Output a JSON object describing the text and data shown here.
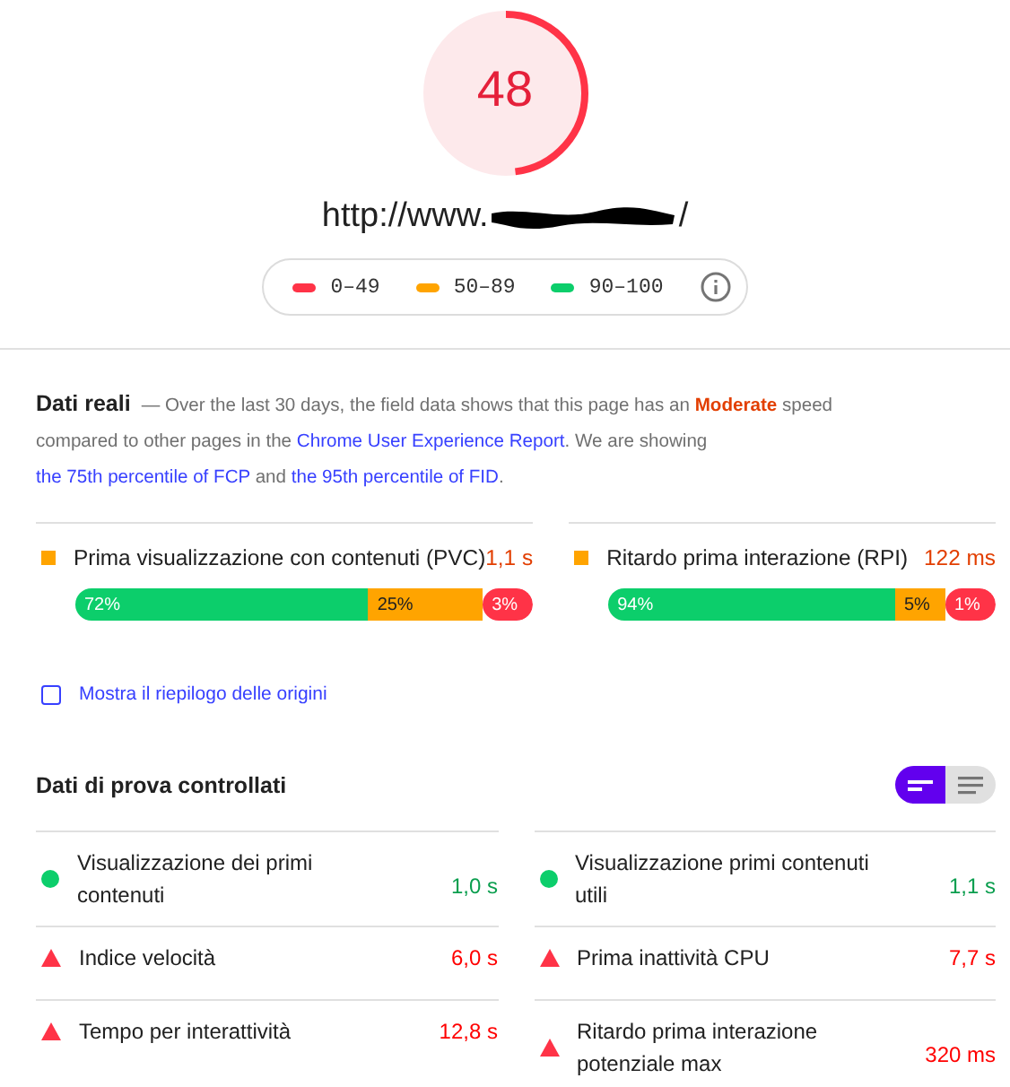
{
  "score": {
    "value": "48"
  },
  "url": {
    "text": "http://www.",
    "suffix": "/"
  },
  "legend": [
    {
      "label": "0–49",
      "color": "#ff3347"
    },
    {
      "label": "50–89",
      "color": "#ffa400"
    },
    {
      "label": "90–100",
      "color": "#0cce6b"
    }
  ],
  "field_data": {
    "title": "Dati reali",
    "description": [
      {
        "kind": "plain",
        "text": "— Over the last 30 days, the field data shows that this page has an "
      },
      {
        "kind": "rating",
        "text": "Moderate"
      },
      {
        "kind": "plain",
        "text": " speed compared to other pages in the "
      },
      {
        "kind": "link",
        "text": "Chrome User Experience Report"
      },
      {
        "kind": "plain",
        "text": ". We are showing "
      },
      {
        "kind": "link",
        "text": "the 75th percentile of FCP"
      },
      {
        "kind": "plain",
        "text": " and "
      },
      {
        "kind": "link",
        "text": "the 95th percentile of FID"
      },
      {
        "kind": "plain",
        "text": "."
      }
    ],
    "metrics": [
      {
        "name": "Prima visualizzazione con contenuti (PVC)",
        "value": "1,1 s",
        "kind": "average",
        "distribution": [
          {
            "label": "72%",
            "kind": "fast"
          },
          {
            "label": "25%",
            "kind": "average"
          },
          {
            "label": "3%",
            "kind": "slow"
          }
        ]
      },
      {
        "name": "Ritardo prima interazione (RPI)",
        "value": "122 ms",
        "kind": "average",
        "distribution": [
          {
            "label": "94%",
            "kind": "fast"
          },
          {
            "label": "5%",
            "kind": "average"
          },
          {
            "label": "1%",
            "kind": "slow"
          }
        ]
      }
    ]
  },
  "origin_summary": {
    "label": "Mostra il riepilogo delle origini",
    "checked": false
  },
  "lab_data": {
    "title": "Dati di prova controllati",
    "views": [
      {
        "kind": "summary",
        "selected": true
      },
      {
        "kind": "list",
        "selected": false
      }
    ],
    "metrics": [
      {
        "name": "Visualizzazione dei primi contenuti",
        "value": "1,0 s",
        "kind": "fast"
      },
      {
        "name": "Visualizzazione primi contenuti utili",
        "value": "1,1 s",
        "kind": "fast"
      },
      {
        "name": "Indice velocità",
        "value": "6,0 s",
        "kind": "slow"
      },
      {
        "name": "Prima inattività CPU",
        "value": "7,7 s",
        "kind": "slow"
      },
      {
        "name": "Tempo per interattività",
        "value": "12,8 s",
        "kind": "slow"
      },
      {
        "name": "Ritardo prima interazione potenziale max",
        "value": "320 ms",
        "kind": "slow"
      }
    ]
  }
}
